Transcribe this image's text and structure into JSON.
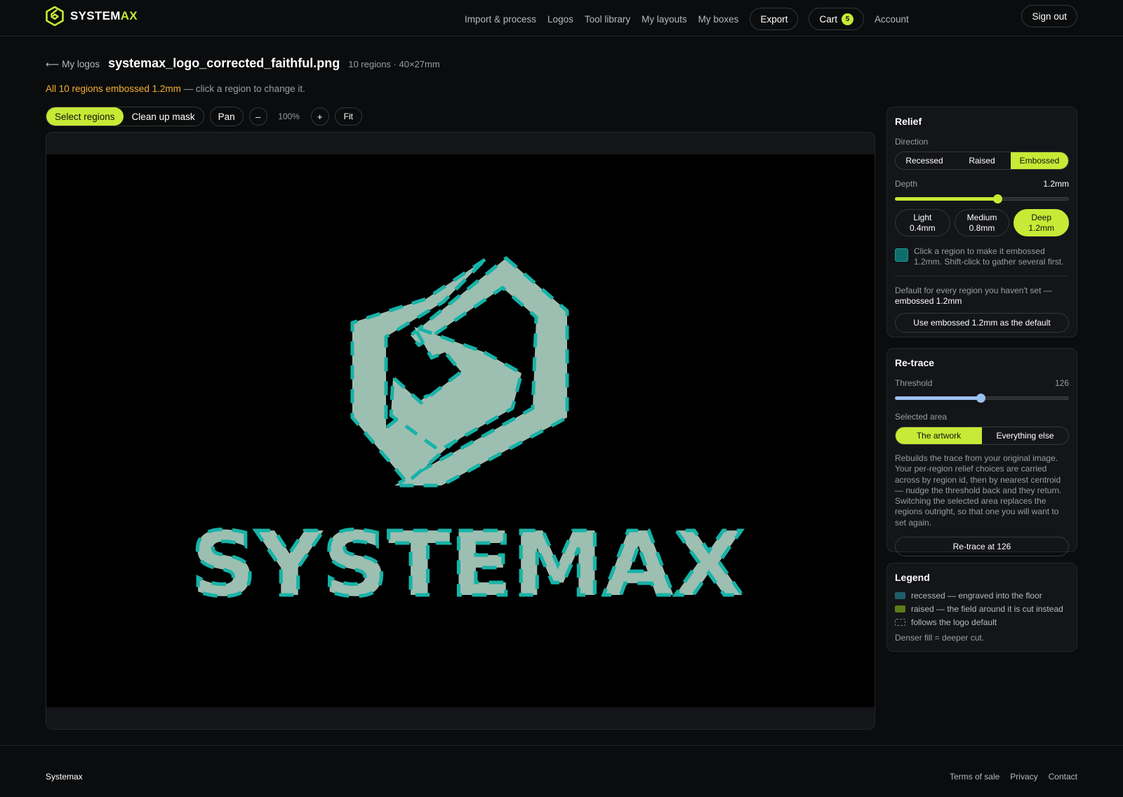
{
  "brand": {
    "name_main": "SYSTEM",
    "name_accent": "AX",
    "accent_color": "#c6ea35"
  },
  "nav": {
    "links": [
      "Import & process",
      "Logos",
      "Tool library",
      "My layouts",
      "My boxes"
    ],
    "export_label": "Export",
    "cart_label": "Cart",
    "cart_count": "5",
    "account_label": "Account",
    "signout_label": "Sign out"
  },
  "page": {
    "back_label": "⟵ My logos",
    "file_name": "systemax_logo_corrected_faithful.png",
    "file_meta": "10 regions · 40×27mm",
    "status_highlight": "All 10 regions embossed 1.2mm",
    "status_rest": " — click a region to change it."
  },
  "toolbar": {
    "select_regions": "Select regions",
    "clean_up_mask": "Clean up mask",
    "pan": "Pan",
    "zoom_out": "–",
    "zoom_level": "100%",
    "zoom_in": "+",
    "fit": "Fit"
  },
  "canvas": {
    "wordmark": "SYSTEMAX",
    "region_fill": "#9dbfb1",
    "region_outline": "#17b3a8"
  },
  "relief": {
    "title": "Relief",
    "direction_label": "Direction",
    "directions": [
      "Recessed",
      "Raised",
      "Embossed"
    ],
    "active_direction": "Embossed",
    "depth_label": "Depth",
    "depth_value": "1.2mm",
    "depth_fraction": 0.59,
    "presets": [
      {
        "name": "Light",
        "value": "0.4mm"
      },
      {
        "name": "Medium",
        "value": "0.8mm"
      },
      {
        "name": "Deep",
        "value": "1.2mm"
      }
    ],
    "active_preset": "Deep",
    "hint": "Click a region to make it embossed 1.2mm. Shift-click to gather several first.",
    "default_intro": "Default for every region you haven't set —",
    "default_value": "embossed 1.2mm",
    "default_button": "Use embossed 1.2mm as the default"
  },
  "retrace": {
    "title": "Re-trace",
    "threshold_label": "Threshold",
    "threshold_value": "126",
    "threshold_fraction": 0.49,
    "area_label": "Selected area",
    "areas": [
      "The artwork",
      "Everything else"
    ],
    "active_area": "The artwork",
    "description": "Rebuilds the trace from your original image. Your per-region relief choices are carried across by region id, then by nearest centroid — nudge the threshold back and they return. Switching the selected area replaces the regions outright, so that one you will want to set again.",
    "button": "Re-trace at 126"
  },
  "legend": {
    "title": "Legend",
    "items": [
      {
        "text": "recessed — engraved into the floor",
        "color": "#1d5f6b"
      },
      {
        "text": "raised — the field around it is cut instead",
        "color": "#5f7a1c"
      },
      {
        "text": "follows the logo default",
        "color": "transparent"
      }
    ],
    "note": "Denser fill = deeper cut."
  },
  "footer": {
    "brand": "Systemax",
    "links": [
      "Terms of sale",
      "Privacy",
      "Contact"
    ]
  }
}
